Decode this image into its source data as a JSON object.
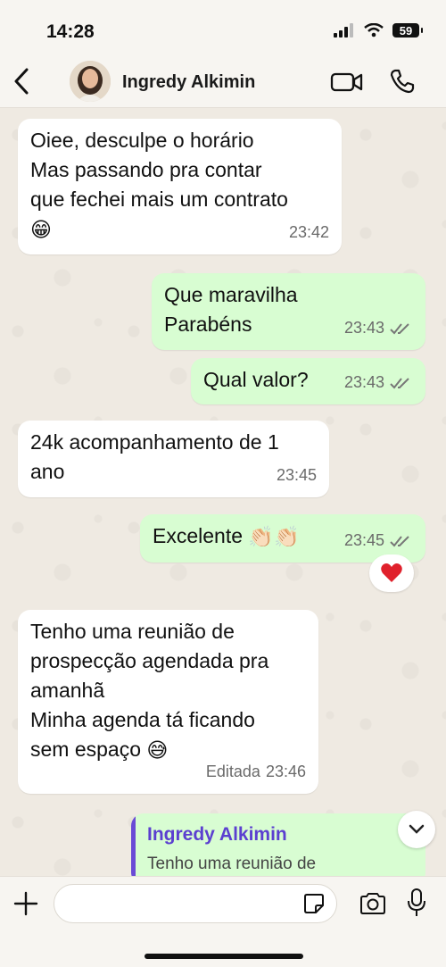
{
  "status": {
    "time": "14:28",
    "battery": "59"
  },
  "header": {
    "contact_name": "Ingredy Alkimin"
  },
  "messages": [
    {
      "direction": "in",
      "lines": [
        "Oiee, desculpe o horário",
        "Mas passando pra contar",
        "que fechei mais um contrato"
      ],
      "emoji": "😁",
      "time": "23:42"
    },
    {
      "direction": "out",
      "lines": [
        "Que maravilha",
        "Parabéns"
      ],
      "time": "23:43",
      "status": "read"
    },
    {
      "direction": "out",
      "lines": [
        "Qual valor?"
      ],
      "time": "23:43",
      "status": "read"
    },
    {
      "direction": "in",
      "lines": [
        "24k acompanhamento de 1",
        "ano"
      ],
      "time": "23:45"
    },
    {
      "direction": "out",
      "lines": [
        "Excelente"
      ],
      "emoji": "👏🏻👏🏻",
      "time": "23:45",
      "status": "read",
      "reaction": "❤️"
    },
    {
      "direction": "in",
      "lines": [
        "Tenho uma reunião de",
        "prospecção agendada pra",
        "amanhã",
        "Minha agenda tá ficando",
        "sem espaço"
      ],
      "emoji": "😅",
      "edited_label": "Editada",
      "time": "23:46"
    }
  ],
  "quoted_reply": {
    "author": "Ingredy Alkimin",
    "text": "Tenho uma reunião de"
  },
  "composer": {
    "placeholder": ""
  },
  "colors": {
    "incoming": "#ffffff",
    "outgoing": "#d8fdd2",
    "accent": "#6a4bd6",
    "tick": "#53bdeb"
  },
  "icons": [
    "back-chevron-icon",
    "video-call-icon",
    "phone-icon",
    "double-check-icon",
    "chevron-down-icon",
    "plus-icon",
    "sticker-icon",
    "camera-icon",
    "microphone-icon"
  ]
}
